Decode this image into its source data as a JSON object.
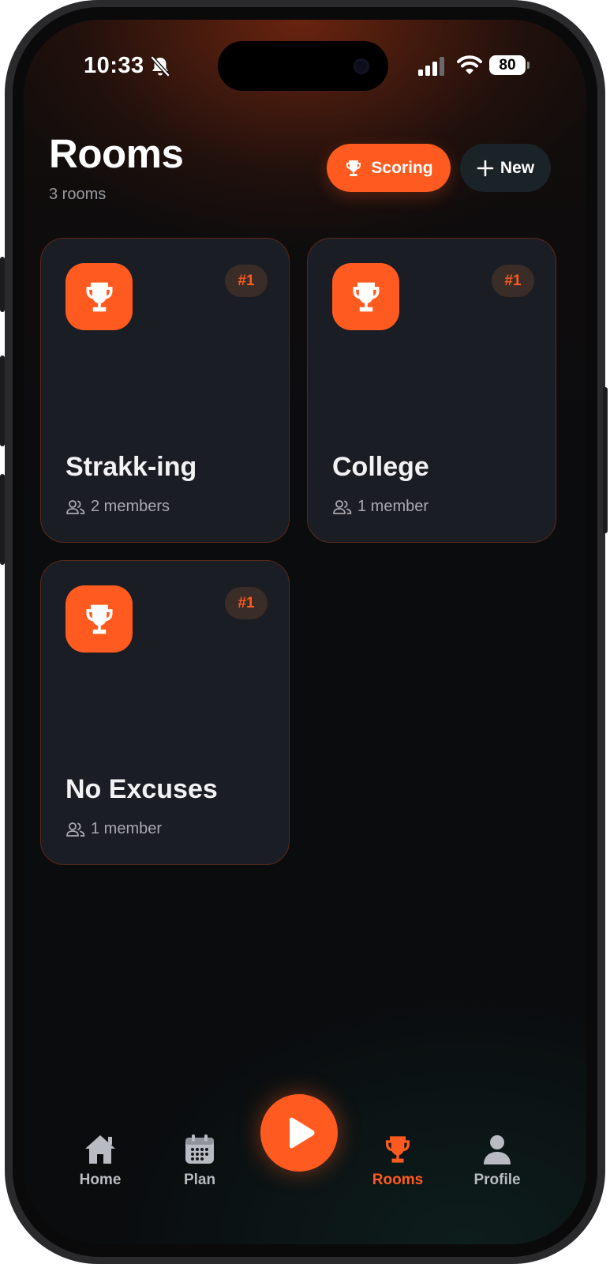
{
  "status_bar": {
    "time": "10:33",
    "battery": "80"
  },
  "header": {
    "title": "Rooms",
    "subtitle": "3 rooms",
    "scoring_label": "Scoring",
    "new_label": "New"
  },
  "rooms": [
    {
      "name": "Strakk-ing",
      "rank": "#1",
      "members": "2 members"
    },
    {
      "name": "College",
      "rank": "#1",
      "members": "1 member"
    },
    {
      "name": "No Excuses",
      "rank": "#1",
      "members": "1 member"
    }
  ],
  "tabbar": {
    "items": [
      {
        "label": "Home",
        "icon": "home-icon"
      },
      {
        "label": "Plan",
        "icon": "calendar-icon"
      },
      {
        "label": "Rooms",
        "icon": "trophy-icon",
        "active": true
      },
      {
        "label": "Profile",
        "icon": "person-icon"
      }
    ],
    "center_icon": "play-icon"
  },
  "colors": {
    "accent": "#ff5a1f",
    "card_bg": "#1b1d24",
    "card_border": "#5a2a1a"
  }
}
